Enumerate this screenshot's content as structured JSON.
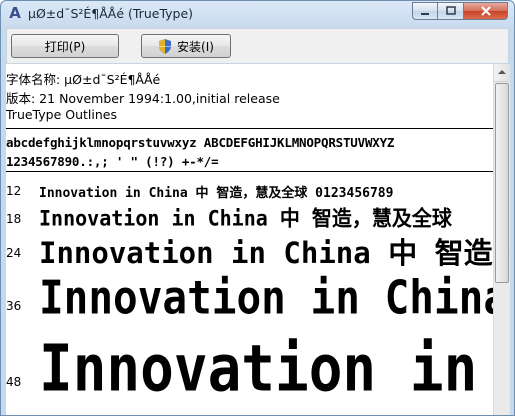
{
  "window": {
    "title": "µØ±d¯S²É¶ÅÅé (TrueType)"
  },
  "toolbar": {
    "print_label": "打印(P)",
    "install_label": "安装(I)"
  },
  "font_info": {
    "name_line": "字体名称: µØ±d¯S²É¶ÅÅé",
    "version_line": "版本: 21 November 1994:1.00,initial release",
    "outline_line": "TrueType Outlines"
  },
  "charset": {
    "line1": "abcdefghijklmnopqrstuvwxyz ABCDEFGHIJKLMNOPQRSTUVWXYZ",
    "line2": "1234567890.:,; ' \" (!?) +-*/="
  },
  "samples": [
    {
      "size": "12",
      "text": "Innovation in China 中  智造，慧及全球 0123456789"
    },
    {
      "size": "18",
      "text": "Innovation in China 中  智造，慧及全球"
    },
    {
      "size": "24",
      "text": "Innovation in China 中  智造"
    },
    {
      "size": "36",
      "text": "Innovation in China"
    },
    {
      "size": "48",
      "text": "Innovation in C"
    }
  ],
  "colors": {
    "title_bg": "#c7d9ee",
    "close_button": "#c7432b",
    "toolbar_bg": "#f0f0f0"
  }
}
